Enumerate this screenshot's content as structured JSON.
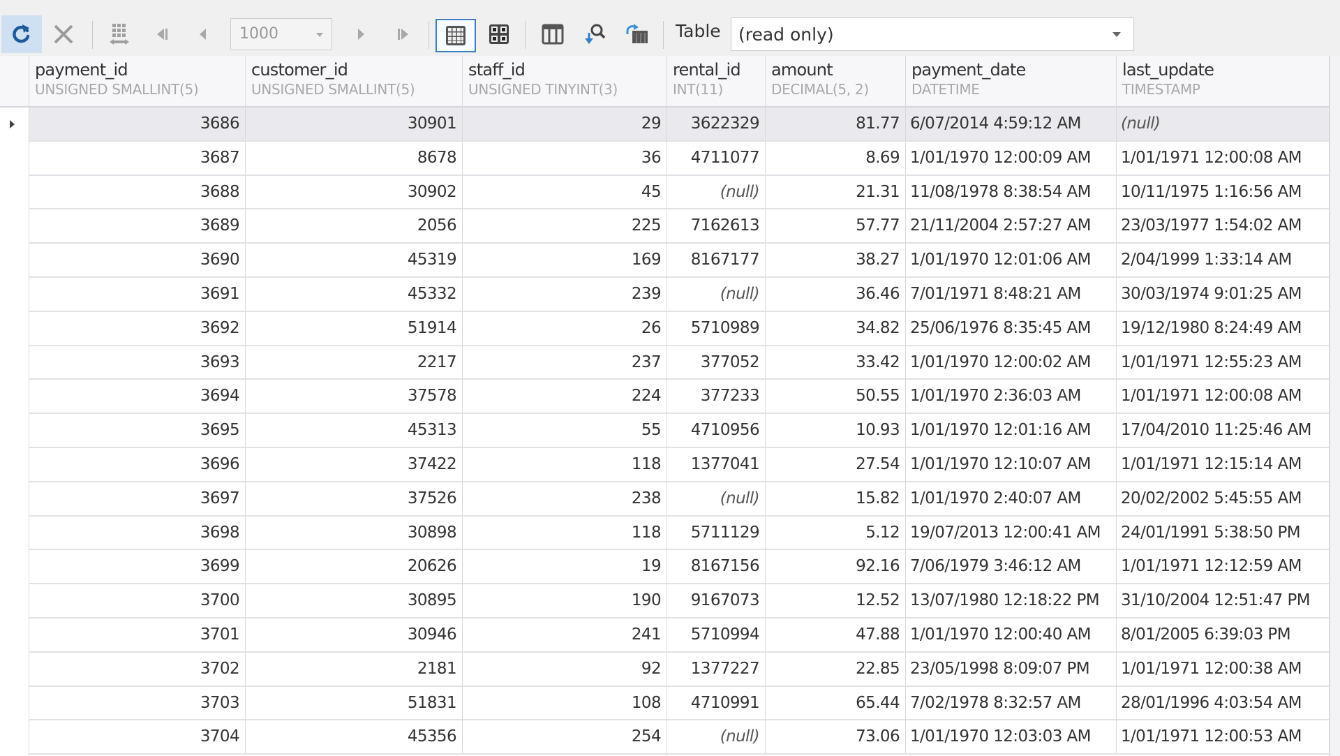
{
  "toolbar": {
    "refresh_icon": "refresh-icon",
    "cancel_icon": "close-icon",
    "page_size": "1000",
    "view_label": "Table",
    "mode_value": "(read only)",
    "accent_color": "#1e5a99"
  },
  "columns": [
    {
      "name": "payment_id",
      "type": "UNSIGNED SMALLINT(5)",
      "align": "num"
    },
    {
      "name": "customer_id",
      "type": "UNSIGNED SMALLINT(5)",
      "align": "num"
    },
    {
      "name": "staff_id",
      "type": "UNSIGNED TINYINT(3)",
      "align": "num"
    },
    {
      "name": "rental_id",
      "type": "INT(11)",
      "align": "num"
    },
    {
      "name": "amount",
      "type": "DECIMAL(5, 2)",
      "align": "num"
    },
    {
      "name": "payment_date",
      "type": "DATETIME",
      "align": "txt"
    },
    {
      "name": "last_update",
      "type": "TIMESTAMP",
      "align": "txt"
    }
  ],
  "null_text": "(null)",
  "selected_row": 0,
  "rows": [
    [
      "3686",
      "30901",
      "29",
      "3622329",
      "81.77",
      "6/07/2014 4:59:12 AM",
      null
    ],
    [
      "3687",
      "8678",
      "36",
      "4711077",
      "8.69",
      "1/01/1970 12:00:09 AM",
      "1/01/1971 12:00:08 AM"
    ],
    [
      "3688",
      "30902",
      "45",
      null,
      "21.31",
      "11/08/1978 8:38:54 AM",
      "10/11/1975 1:16:56 AM"
    ],
    [
      "3689",
      "2056",
      "225",
      "7162613",
      "57.77",
      "21/11/2004 2:57:27 AM",
      "23/03/1977 1:54:02 AM"
    ],
    [
      "3690",
      "45319",
      "169",
      "8167177",
      "38.27",
      "1/01/1970 12:01:06 AM",
      "2/04/1999 1:33:14 AM"
    ],
    [
      "3691",
      "45332",
      "239",
      null,
      "36.46",
      "7/01/1971 8:48:21 AM",
      "30/03/1974 9:01:25 AM"
    ],
    [
      "3692",
      "51914",
      "26",
      "5710989",
      "34.82",
      "25/06/1976 8:35:45 AM",
      "19/12/1980 8:24:49 AM"
    ],
    [
      "3693",
      "2217",
      "237",
      "377052",
      "33.42",
      "1/01/1970 12:00:02 AM",
      "1/01/1971 12:55:23 AM"
    ],
    [
      "3694",
      "37578",
      "224",
      "377233",
      "50.55",
      "1/01/1970 2:36:03 AM",
      "1/01/1971 12:00:08 AM"
    ],
    [
      "3695",
      "45313",
      "55",
      "4710956",
      "10.93",
      "1/01/1970 12:01:16 AM",
      "17/04/2010 11:25:46 AM"
    ],
    [
      "3696",
      "37422",
      "118",
      "1377041",
      "27.54",
      "1/01/1970 12:10:07 AM",
      "1/01/1971 12:15:14 AM"
    ],
    [
      "3697",
      "37526",
      "238",
      null,
      "15.82",
      "1/01/1970 2:40:07 AM",
      "20/02/2002 5:45:55 AM"
    ],
    [
      "3698",
      "30898",
      "118",
      "5711129",
      "5.12",
      "19/07/2013 12:00:41 AM",
      "24/01/1991 5:38:50 PM"
    ],
    [
      "3699",
      "20626",
      "19",
      "8167156",
      "92.16",
      "7/06/1979 3:46:12 AM",
      "1/01/1971 12:12:59 AM"
    ],
    [
      "3700",
      "30895",
      "190",
      "9167073",
      "12.52",
      "13/07/1980 12:18:22 PM",
      "31/10/2004 12:51:47 PM"
    ],
    [
      "3701",
      "30946",
      "241",
      "5710994",
      "47.88",
      "1/01/1970 12:00:40 AM",
      "8/01/2005 6:39:03 PM"
    ],
    [
      "3702",
      "2181",
      "92",
      "1377227",
      "22.85",
      "23/05/1998 8:09:07 PM",
      "1/01/1971 12:00:38 AM"
    ],
    [
      "3703",
      "51831",
      "108",
      "4710991",
      "65.44",
      "7/02/1978 8:32:57 AM",
      "28/01/1996 4:03:54 AM"
    ],
    [
      "3704",
      "45356",
      "254",
      null,
      "73.06",
      "1/01/1970 12:03:03 AM",
      "1/01/1971 12:00:53 AM"
    ]
  ]
}
